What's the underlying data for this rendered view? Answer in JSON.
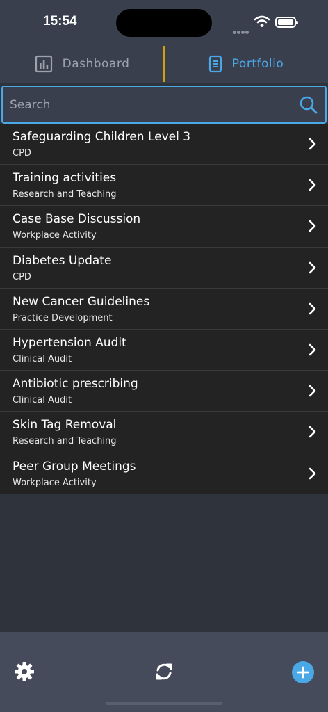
{
  "status_bar": {
    "time": "15:54"
  },
  "tabs": [
    {
      "label": "Dashboard",
      "icon": "bar-chart-icon",
      "active": false
    },
    {
      "label": "Portfolio",
      "icon": "document-icon",
      "active": true
    }
  ],
  "colors": {
    "accent": "#4aa8e6",
    "divider": "#d4a10c",
    "list_bg": "#232323",
    "toolbar_bg": "#464b5c"
  },
  "search": {
    "placeholder": "Search",
    "value": ""
  },
  "items": [
    {
      "title": "Safeguarding Children Level 3",
      "subtitle": "CPD"
    },
    {
      "title": "Training activities",
      "subtitle": "Research and Teaching"
    },
    {
      "title": "Case Base Discussion",
      "subtitle": "Workplace Activity"
    },
    {
      "title": "Diabetes Update",
      "subtitle": "CPD"
    },
    {
      "title": "New Cancer Guidelines",
      "subtitle": "Practice Development"
    },
    {
      "title": "Hypertension Audit",
      "subtitle": "Clinical Audit"
    },
    {
      "title": "Antibiotic prescribing",
      "subtitle": "Clinical Audit"
    },
    {
      "title": "Skin Tag Removal",
      "subtitle": "Research and Teaching"
    },
    {
      "title": "Peer Group Meetings",
      "subtitle": "Workplace Activity"
    }
  ],
  "toolbar": {
    "icons": [
      "gear-icon",
      "sync-icon",
      "plus-icon"
    ]
  }
}
